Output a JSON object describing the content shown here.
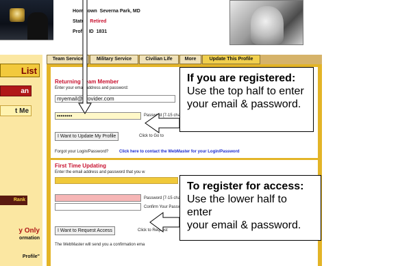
{
  "profile": {
    "hometown_label": "Hometown",
    "hometown_value": "Severna Park, MD",
    "status_label": "Status",
    "status_value": "Retired",
    "profile_id_label": "Profile ID",
    "profile_id_value": "1831"
  },
  "sidebar": {
    "list_label": "List",
    "btn1_label": "an",
    "btn2_label": "t Me",
    "rank_label": "Rank",
    "only_label": "y Only",
    "info_label": "ormation",
    "quote_label": "Profile\""
  },
  "tabs": [
    {
      "label": "Team Service"
    },
    {
      "label": "Military Service"
    },
    {
      "label": "Civilian Life"
    },
    {
      "label": "More"
    },
    {
      "label": "Update This Profile"
    }
  ],
  "returning": {
    "title": "Returning Team Member",
    "subtitle": "Enter your email address and password:",
    "email_value": "myemail@provider.com",
    "password_value": "••••••••",
    "password_label": "Password  [7-15 chara",
    "update_button": "I Want to Update My Profile",
    "update_hint": "Click to Go to",
    "forgot_text": "Forgot your Login/Password?",
    "forgot_link": "Click here to contact the WebMaster for your Login/Password"
  },
  "first_time": {
    "title": "First Time Updating",
    "subtitle": "Enter the email address and password that you w",
    "password_label": "Password  [7-15 cha",
    "confirm_label": "Confirm Your Passwo",
    "request_button": "I Want to Request Access",
    "request_hint": "Click to Request",
    "webmaster_note": "The WebMaster will send you a confirmation ema"
  },
  "callouts": {
    "registered": {
      "title": "If you are registered:",
      "line1": "Use the top half to enter",
      "line2": "your email & password."
    },
    "register": {
      "title": "To register for access:",
      "line1": "Use the lower half to enter",
      "line2": "your email & password."
    }
  }
}
